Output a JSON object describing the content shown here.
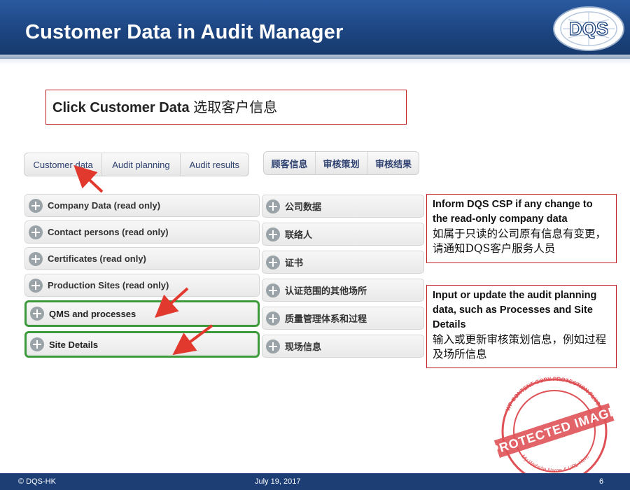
{
  "header": {
    "title": "Customer Data in Audit Manager",
    "logo_text": "DQS"
  },
  "instruction": {
    "bold": "Click Customer Data",
    "cn": " 选取客户信息"
  },
  "tabs_en": [
    "Customer data",
    "Audit planning",
    "Audit results"
  ],
  "tabs_cn": [
    "顾客信息",
    "审核策划",
    "审核结果"
  ],
  "sections_en": [
    "Company Data (read only)",
    "Contact persons (read only)",
    "Certificates (read only)",
    "Production Sites (read only)",
    "QMS and processes",
    "Site Details"
  ],
  "sections_cn": [
    "公司数据",
    "联络人",
    "证书",
    "认证范围的其他场所",
    "质量管理体系和过程",
    "现场信息"
  ],
  "notes": {
    "note1_en": "Inform DQS CSP if any change to the read-only company data",
    "note1_cn": "如属于只读的公司原有信息有变更，请通知DQS客户服务人员",
    "note2_en": "Input or update the audit planning data, such as Processes and Site Details",
    "note2_cn": "输入或更新审核策划信息，例如过程及场所信息"
  },
  "watermark": {
    "main": "PROTECTED IMAGE",
    "ring_top": "WP CONTENT COPY PROTECTION PLUGIN",
    "ring_bottom": "My Website Name & URL Here"
  },
  "footer": {
    "left": "© DQS-HK",
    "center": "July 19, 2017",
    "page": "6"
  },
  "colors": {
    "title_bar": "#1c447f",
    "callout_border": "#c02025",
    "highlight_border": "#3c9a3c",
    "arrow": "#e2392f",
    "stamp": "#d9343a"
  }
}
